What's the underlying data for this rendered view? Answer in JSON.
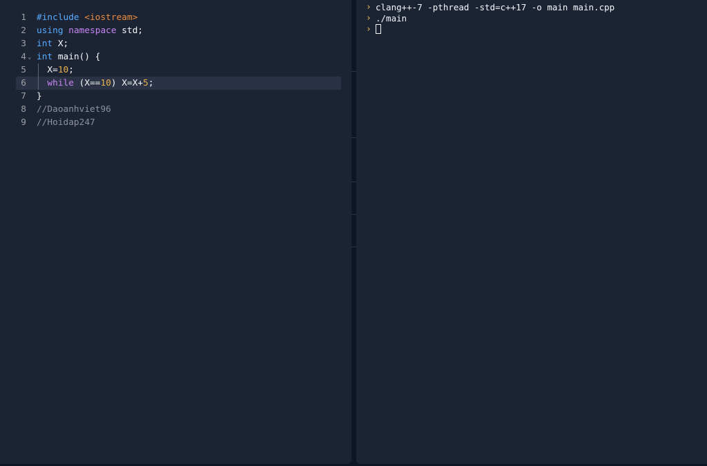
{
  "editor": {
    "language": "cpp",
    "active_line": 6,
    "lines": [
      {
        "number": "1",
        "tokens": [
          {
            "text": "#include",
            "kind": "blue"
          },
          {
            "text": " ",
            "kind": "plain"
          },
          {
            "text": "<iostream>",
            "kind": "str"
          }
        ]
      },
      {
        "number": "2",
        "tokens": [
          {
            "text": "using",
            "kind": "blue"
          },
          {
            "text": " ",
            "kind": "plain"
          },
          {
            "text": "namespace",
            "kind": "purple"
          },
          {
            "text": " std;",
            "kind": "plain"
          }
        ]
      },
      {
        "number": "3",
        "tokens": [
          {
            "text": "int",
            "kind": "blue"
          },
          {
            "text": " X;",
            "kind": "plain"
          }
        ]
      },
      {
        "number": "4",
        "fold": true,
        "tokens": [
          {
            "text": "int",
            "kind": "blue"
          },
          {
            "text": " main() {",
            "kind": "plain"
          }
        ]
      },
      {
        "number": "5",
        "guide": true,
        "tokens": [
          {
            "text": "  X=",
            "kind": "plain"
          },
          {
            "text": "10",
            "kind": "num"
          },
          {
            "text": ";",
            "kind": "plain"
          }
        ]
      },
      {
        "number": "6",
        "guide": true,
        "tokens": [
          {
            "text": "  ",
            "kind": "plain"
          },
          {
            "text": "while",
            "kind": "purple"
          },
          {
            "text": " (X==",
            "kind": "plain"
          },
          {
            "text": "10",
            "kind": "num"
          },
          {
            "text": ") X=X+",
            "kind": "plain"
          },
          {
            "text": "5",
            "kind": "num"
          },
          {
            "text": ";",
            "kind": "plain"
          }
        ]
      },
      {
        "number": "7",
        "tokens": [
          {
            "text": "}",
            "kind": "plain"
          }
        ]
      },
      {
        "number": "8",
        "tokens": [
          {
            "text": "//Daoanhviet96",
            "kind": "cmt"
          }
        ]
      },
      {
        "number": "9",
        "tokens": [
          {
            "text": "//Hoidap247",
            "kind": "cmt"
          }
        ]
      }
    ]
  },
  "console": {
    "prompt_icon": "chevron-right-icon",
    "lines": [
      {
        "text": "clang++-7 -pthread -std=c++17 -o main main.cpp"
      },
      {
        "text": "./main"
      },
      {
        "text": "",
        "cursor": true
      }
    ]
  },
  "colors": {
    "background": "#1c2333",
    "keyword_blue": "#57abff",
    "keyword_purple": "#c586f2",
    "string": "#e88b3d",
    "number": "#e9b44c",
    "comment": "#8b919f",
    "prompt": "#e9b44c"
  }
}
